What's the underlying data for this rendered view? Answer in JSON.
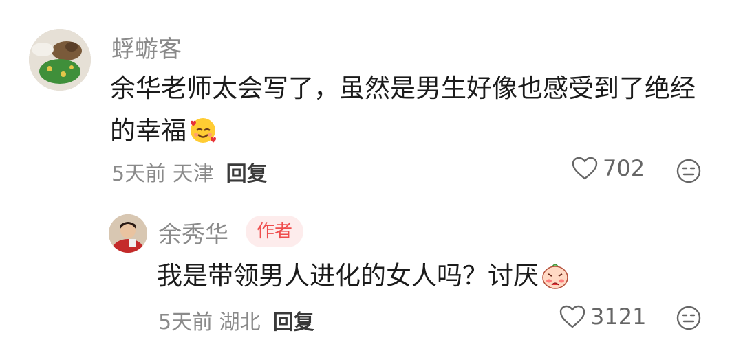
{
  "comment": {
    "username": "蜉蝣客",
    "text": "余华老师太会写了，虽然是男生好像也感受到了绝经的幸福",
    "time": "5天前",
    "location": "天津",
    "reply_label": "回复",
    "likes": "702",
    "emoji": "smiling-face-with-hearts-icon"
  },
  "reply": {
    "username": "余秀华",
    "author_badge": "作者",
    "text": "我是带领男人进化的女人吗？讨厌",
    "time": "5天前",
    "location": "湖北",
    "reply_label": "回复",
    "likes": "3121",
    "emoji": "shy-face-icon"
  },
  "colors": {
    "username": "#8a8a8a",
    "badge_text": "#ef4d4d",
    "badge_bg": "#fdecec",
    "text": "#1b1b1b"
  }
}
